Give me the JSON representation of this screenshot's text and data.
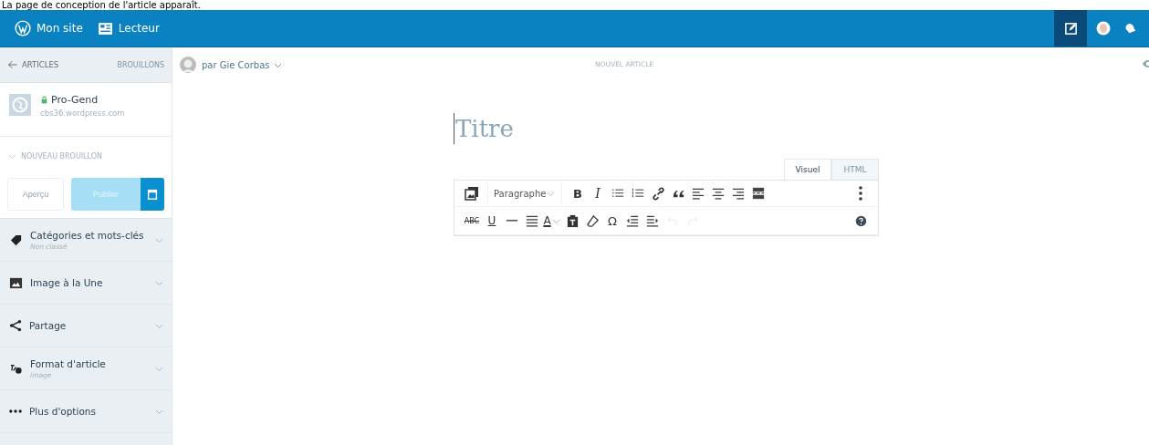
{
  "caption": "La page de conception de l'article apparaît.",
  "masterbar": {
    "items": [
      {
        "kind": "wp",
        "label": "Mon site"
      },
      {
        "kind": "reader",
        "label": "Lecteur"
      }
    ],
    "actions": [
      {
        "kind": "write",
        "selected": true
      },
      {
        "kind": "avatar",
        "selected": false
      },
      {
        "kind": "notifications",
        "selected": false
      }
    ]
  },
  "sidebar": {
    "back": "ARTICLES",
    "drafts": "BROUILLONS",
    "site": {
      "name": "Pro-Gend",
      "url": "cbs36.wordpress.com"
    },
    "draft_status": "NOUVEAU BROUILLON",
    "buttons": [
      {
        "kind": "preview",
        "label": "Aperçu",
        "disabled": true
      },
      {
        "kind": "publish",
        "label": "Publier",
        "disabled": true
      },
      {
        "kind": "schedule",
        "disabled": false
      }
    ],
    "sections": [
      {
        "kind": "tag",
        "label": "Catégories et mots-clés",
        "detail": "Non classé"
      },
      {
        "kind": "image",
        "label": "Image à la Une"
      },
      {
        "kind": "share",
        "label": "Partage"
      },
      {
        "kind": "format",
        "label": "Format d'article",
        "detail": "Image"
      },
      {
        "kind": "more",
        "label": "Plus d'options"
      }
    ]
  },
  "editor": {
    "author": "par Gie Corbas",
    "status": "NOUVEL ARTICLE",
    "title_placeholder": "Titre",
    "tabs": [
      {
        "label": "Visuel",
        "selected": true
      },
      {
        "label": "HTML",
        "selected": false
      }
    ],
    "rows": [
      {
        "tools": [
          {
            "kind": "media",
            "disabled": false
          },
          {
            "kind": "select",
            "label": "Paragraphe",
            "disabled": false
          },
          {
            "kind": "bold",
            "label": "B",
            "disabled": false
          },
          {
            "kind": "italic",
            "label": "I",
            "disabled": false
          },
          {
            "kind": "ul",
            "disabled": false
          },
          {
            "kind": "ol",
            "disabled": false
          },
          {
            "kind": "link",
            "disabled": false
          },
          {
            "kind": "quote",
            "disabled": false
          },
          {
            "kind": "align-left",
            "disabled": false
          },
          {
            "kind": "align-center",
            "disabled": false
          },
          {
            "kind": "align-right",
            "disabled": false
          },
          {
            "kind": "readmore",
            "disabled": false
          }
        ],
        "end": {
          "kind": "kebab"
        }
      },
      {
        "tools": [
          {
            "kind": "strike",
            "label": "ABC",
            "disabled": false
          },
          {
            "kind": "underline",
            "label": "U",
            "disabled": false
          },
          {
            "kind": "hr",
            "disabled": false
          },
          {
            "kind": "justify",
            "disabled": false
          },
          {
            "kind": "color",
            "label": "A",
            "disabled": false
          },
          {
            "kind": "paste",
            "disabled": false
          },
          {
            "kind": "eraser",
            "disabled": false
          },
          {
            "kind": "char",
            "label": "Ω",
            "disabled": false
          },
          {
            "kind": "outdent",
            "disabled": false
          },
          {
            "kind": "indent",
            "disabled": false
          },
          {
            "kind": "undo",
            "disabled": true
          },
          {
            "kind": "redo",
            "disabled": true
          }
        ],
        "end": {
          "kind": "help"
        }
      }
    ]
  }
}
